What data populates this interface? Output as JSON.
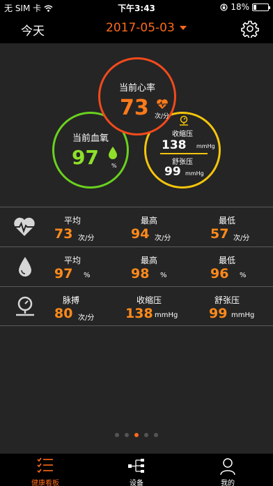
{
  "status_bar": {
    "carrier": "无 SIM 卡",
    "time": "下午3:43",
    "battery": "18%"
  },
  "nav": {
    "title": "今天",
    "date": "2017-05-03"
  },
  "summary": {
    "heart_rate": {
      "label": "当前心率",
      "value": "73",
      "unit": "次/分"
    },
    "blood_oxygen": {
      "label": "当前血氧",
      "value": "97",
      "unit": "%"
    },
    "blood_pressure": {
      "systolic_label": "收缩压",
      "systolic_value": "138",
      "systolic_unit": "mmHg",
      "diastolic_label": "舒张压",
      "diastolic_value": "99",
      "diastolic_unit": "mmHg"
    }
  },
  "stats": [
    {
      "icon": "heart-pulse-icon",
      "cells": [
        {
          "header": "平均",
          "value": "73",
          "unit": "次/分"
        },
        {
          "header": "最高",
          "value": "94",
          "unit": "次/分"
        },
        {
          "header": "最低",
          "value": "57",
          "unit": "次/分"
        }
      ]
    },
    {
      "icon": "drop-icon",
      "cells": [
        {
          "header": "平均",
          "value": "97",
          "unit": "%"
        },
        {
          "header": "最高",
          "value": "98",
          "unit": "%"
        },
        {
          "header": "最低",
          "value": "96",
          "unit": "%"
        }
      ]
    },
    {
      "icon": "blood-pressure-gauge-icon",
      "cells": [
        {
          "header": "脉搏",
          "value": "80",
          "unit": "次/分"
        },
        {
          "header": "收缩压",
          "value": "138",
          "unit": "mmHg"
        },
        {
          "header": "舒张压",
          "value": "99",
          "unit": "mmHg"
        }
      ]
    }
  ],
  "pager": {
    "count": 5,
    "active": 3
  },
  "tabs": [
    {
      "label": "健康看板",
      "icon": "checklist-icon",
      "active": true
    },
    {
      "label": "设备",
      "icon": "device-tree-icon",
      "active": false
    },
    {
      "label": "我的",
      "icon": "person-icon",
      "active": false
    }
  ],
  "colors": {
    "accent": "#ff6a1a",
    "heart": "#f24a1c",
    "oxygen": "#6ad11f",
    "pressure": "#f5c50c",
    "background": "#252525"
  }
}
